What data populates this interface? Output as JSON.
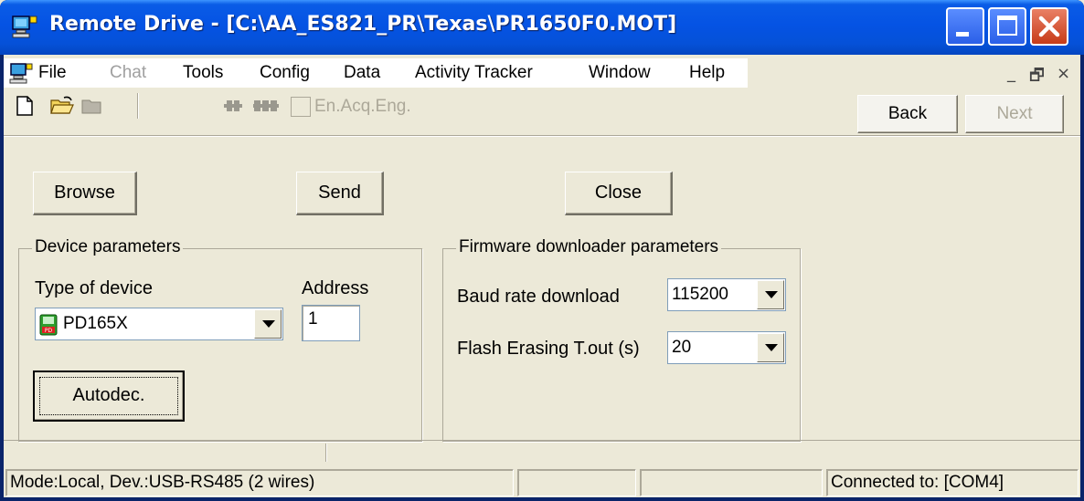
{
  "window": {
    "title": "Remote Drive - [C:\\AA_ES821_PR\\Texas\\PR1650F0.MOT]",
    "app_icon": "computer-network-icon"
  },
  "menu": {
    "items": [
      {
        "label": "File",
        "enabled": true
      },
      {
        "label": "Chat",
        "enabled": false
      },
      {
        "label": "Tools",
        "enabled": true
      },
      {
        "label": "Config",
        "enabled": true
      },
      {
        "label": "Data",
        "enabled": true
      },
      {
        "label": "Activity Tracker",
        "enabled": true
      },
      {
        "label": "Window",
        "enabled": true
      },
      {
        "label": "Help",
        "enabled": true
      }
    ],
    "mdi_controls": {
      "minimize": "_",
      "restore": "🗗",
      "close": "×"
    }
  },
  "toolbar": {
    "icons": [
      "new-file-icon",
      "open-folder-icon",
      "folder-icon",
      "connect-icon",
      "disconnect-icon"
    ],
    "checkbox_label": "En.Acq.Eng.",
    "checkbox_checked": false,
    "back_label": "Back",
    "next_label": "Next"
  },
  "actions": {
    "browse": "Browse",
    "send": "Send",
    "close": "Close"
  },
  "device_params": {
    "title": "Device parameters",
    "type_label": "Type of device",
    "type_value": "PD165X",
    "address_label": "Address",
    "address_value": "1",
    "autodec_label": "Autodec."
  },
  "firmware_params": {
    "title": "Firmware downloader parameters",
    "baud_label": "Baud rate download",
    "baud_value": "115200",
    "erase_label": "Flash Erasing T.out (s)",
    "erase_value": "20"
  },
  "status": {
    "mode": "Mode:Local, Dev.:USB-RS485 (2 wires)",
    "cell2": "",
    "cell3": "",
    "connection": "Connected to: [COM4]"
  },
  "colors": {
    "titlebar": "#0553e4",
    "face": "#ece9d8",
    "close_button": "#c73b18"
  }
}
